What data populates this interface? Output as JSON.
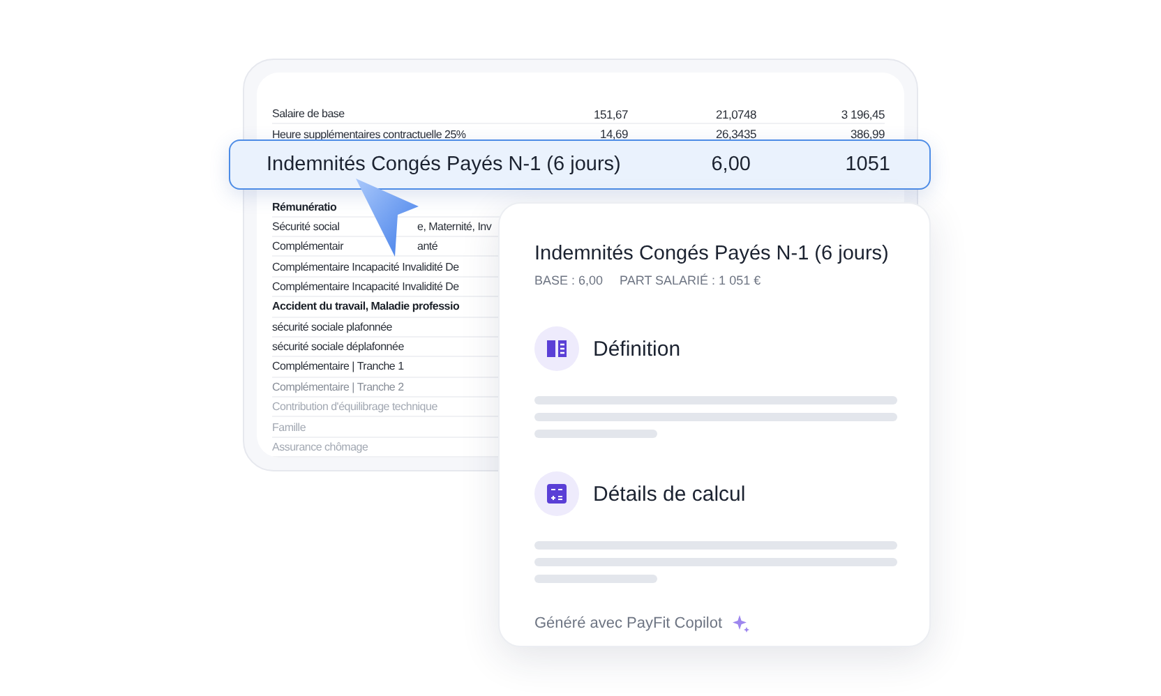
{
  "payslip": {
    "rows_above": [
      {
        "parts": [
          "Salaire de base"
        ],
        "values": [
          "151,67",
          "21,0748",
          "3 196,45"
        ]
      },
      {
        "parts": [
          "Heure supplémentaires contractuelle 25%"
        ],
        "values": [
          "14,69",
          "26,3435",
          "386,99"
        ]
      }
    ],
    "rows_below": [
      {
        "kind": "bold",
        "parts": [
          "Rémunératio"
        ]
      },
      {
        "kind": "plain",
        "parts": [
          "Sécurité social",
          "e, Maternité, Inv"
        ]
      },
      {
        "kind": "plain",
        "parts": [
          "Complémentair",
          "anté"
        ]
      },
      {
        "kind": "plain",
        "parts": [
          "Complémentaire Incapacité Invalidité De"
        ]
      },
      {
        "kind": "plain",
        "parts": [
          "Complémentaire Incapacité Invalidité De"
        ]
      },
      {
        "kind": "bold",
        "parts": [
          "Accident du travail, Maladie professio"
        ]
      },
      {
        "kind": "plain",
        "parts": [
          "sécurité sociale plafonnée"
        ]
      },
      {
        "kind": "plain",
        "parts": [
          "sécurité sociale déplafonnée"
        ]
      },
      {
        "kind": "plain",
        "parts": [
          "Complémentaire | Tranche 1"
        ]
      },
      {
        "kind": "muted",
        "parts": [
          "Complémentaire | Tranche 2"
        ]
      },
      {
        "kind": "faint",
        "parts": [
          "Contribution d'équilibrage technique"
        ]
      },
      {
        "kind": "faint",
        "parts": [
          "Famille"
        ]
      },
      {
        "kind": "faint",
        "parts": [
          "Assurance chômage"
        ]
      }
    ]
  },
  "highlight": {
    "label": "Indemnités Congés Payés N-1 (6 jours)",
    "base": "6,00",
    "amount": "1051"
  },
  "detail": {
    "title": "Indemnités Congés Payés N-1 (6 jours)",
    "meta": [
      "BASE : 6,00",
      "PART SALARIÉ : 1 051 €"
    ],
    "sections": [
      {
        "kind": "book",
        "title": "Définition"
      },
      {
        "kind": "calculator",
        "title": "Détails de calcul"
      }
    ],
    "footer": "Généré avec PayFit Copilot"
  }
}
